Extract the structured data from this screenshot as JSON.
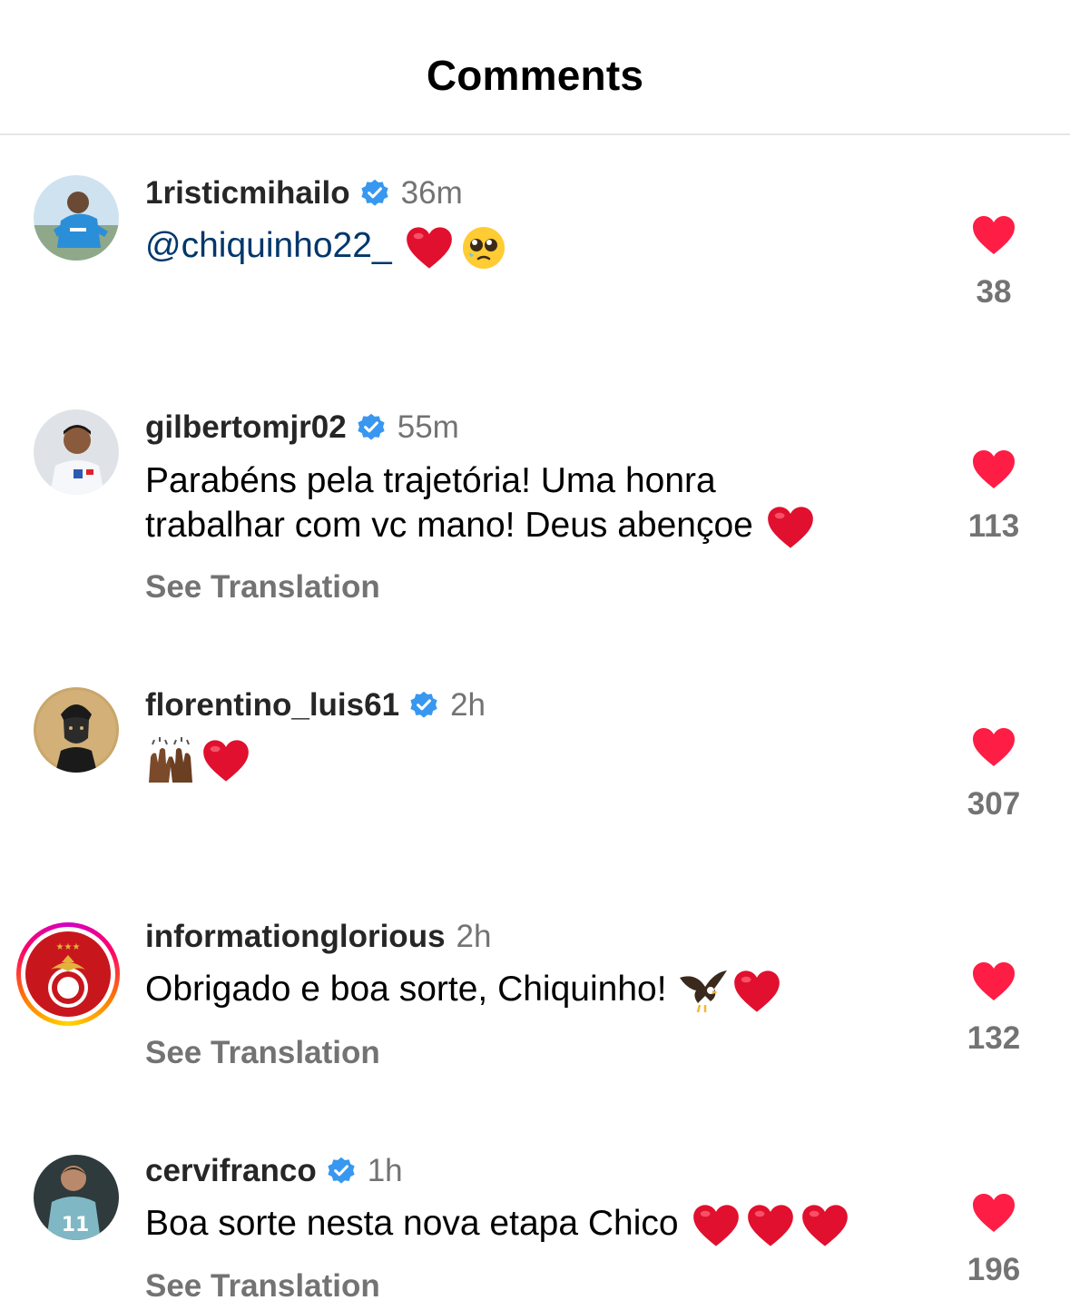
{
  "header": {
    "title": "Comments"
  },
  "colors": {
    "heart": "#fe1d45",
    "verified": "#3897f0",
    "mention": "#00376b",
    "secondary_text": "#737373"
  },
  "comments": [
    {
      "username": "1risticmihailo",
      "verified": true,
      "time": "36m",
      "mention": "@chiquinho22_",
      "text": "",
      "emojis": [
        "red-heart",
        "pleading-face"
      ],
      "see_translation": "",
      "likes": "38"
    },
    {
      "username": "gilbertomjr02",
      "verified": true,
      "time": "55m",
      "text_line1": "Parabéns pela trajetória! Uma honra",
      "text_line2": "trabalhar com vc mano! Deus abençoe",
      "emojis": [
        "red-heart"
      ],
      "see_translation": "See Translation",
      "likes": "113"
    },
    {
      "username": "florentino_luis61",
      "verified": true,
      "time": "2h",
      "text": "",
      "emojis": [
        "raising-hands",
        "red-heart"
      ],
      "see_translation": "",
      "likes": "307"
    },
    {
      "username": "informationglorious",
      "verified": false,
      "time": "2h",
      "text": "Obrigado e boa sorte, Chiquinho!",
      "emojis": [
        "eagle",
        "red-heart"
      ],
      "see_translation": "See Translation",
      "likes": "132"
    },
    {
      "username": "cervifranco",
      "verified": true,
      "time": "1h",
      "text": "Boa sorte nesta nova etapa Chico",
      "emojis": [
        "red-heart",
        "red-heart",
        "red-heart"
      ],
      "see_translation": "See Translation",
      "likes": "196"
    }
  ]
}
